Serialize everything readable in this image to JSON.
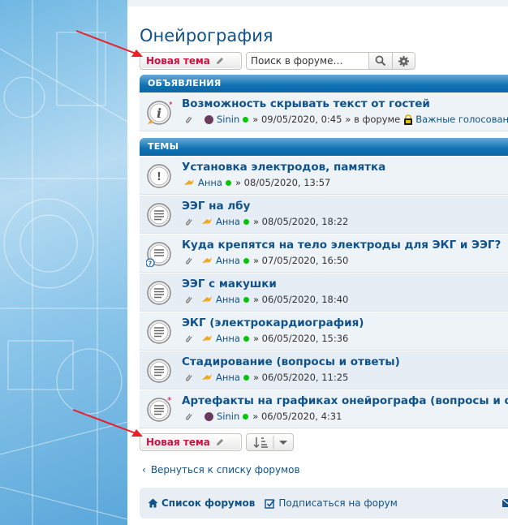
{
  "forum": {
    "title": "Онейрография",
    "new_topic_label": "Новая тема",
    "search_placeholder": "Поиск в форуме…"
  },
  "announcements": {
    "header": "ОБЪЯВЛЕНИЯ",
    "items": [
      {
        "title": "Возможность скрывать текст от гостей",
        "author": "Sinin",
        "date": "» 09/05/2020, 0:45",
        "in_forum": "» в форуме",
        "forum_name": "Важные голосовани"
      }
    ]
  },
  "topics": {
    "header": "ТЕМЫ",
    "items": [
      {
        "title": "Установка электродов, памятка",
        "author": "Анна",
        "date": "» 08/05/2020, 13:57",
        "icon": "sticky-icon"
      },
      {
        "title": "ЭЭГ на лбу",
        "author": "Анна",
        "date": "» 08/05/2020, 18:22",
        "icon": "topic-icon"
      },
      {
        "title": "Куда крепятся на тело электроды для ЭКГ и ЭЭГ?",
        "author": "Анна",
        "date": "» 07/05/2020, 16:50",
        "icon": "question-topic-icon"
      },
      {
        "title": "ЭЭГ с макушки",
        "author": "Анна",
        "date": "» 06/05/2020, 18:40",
        "icon": "topic-icon"
      },
      {
        "title": "ЭКГ (электрокардиография)",
        "author": "Анна",
        "date": "» 06/05/2020, 15:36",
        "icon": "topic-icon"
      },
      {
        "title": "Стадирование (вопросы и ответы)",
        "author": "Анна",
        "date": "» 06/05/2020, 11:25",
        "icon": "topic-icon"
      },
      {
        "title": "Артефакты на графиках онейрографа (вопросы и ответы)",
        "author": "Sinin",
        "date": "» 06/05/2020, 4:31",
        "icon": "new-topic-icon"
      }
    ]
  },
  "footer": {
    "back_link": "Вернуться к списку форумов",
    "nav_forums": "Список форумов",
    "nav_subscribe": "Подписаться на форум"
  },
  "colors": {
    "accent": "#105289",
    "new_topic": "#d31141",
    "header_blue": "#0f72b3",
    "online": "#00c800",
    "annotation_arrow": "#e8202a"
  }
}
